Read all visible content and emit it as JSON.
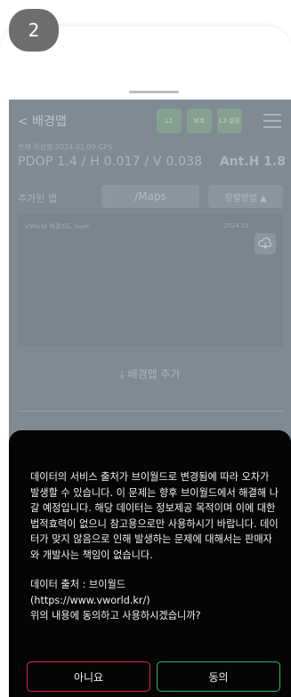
{
  "step_badge": "2",
  "app": {
    "title": "< 배경맵",
    "header_buttons": [
      "L1",
      "보호",
      "L3 설정"
    ],
    "info_line": "현재 위성맵 2024.01.09 GPS",
    "pdop": "PDOP 1.4 / H 0.017 / V 0.038",
    "ant": "Ant.H 1.8",
    "row_label": "추가된 맵",
    "map_button": "/Maps",
    "sort_button": "정렬방법 ▲",
    "list_item_text": "VWorld 배경지도 layer",
    "list_item_date": "2024.01",
    "add_layer": "배경맵 추가"
  },
  "modal": {
    "message": "데이터의 서비스 출처가 브이월드로 변경됨에 따라 오차가 발생할 수 있습니다. 이 문제는 향후 브이월드에서 해결해 나갈 예정입니다. 해당 데이터는 정보제공 목적이며 이에 대한 법적효력이 없으니 참고용으로만 사용하시기 바랍니다. 데이터가 맞지 않음으로 인해 발생하는 문제에 대해서는 판매자와 개발사는 책임이 없습니다.",
    "source_label": "데이터 출처 : 브이월드",
    "source_url": "(https://www.vworld.kr/)",
    "question": "위의 내용에 동의하고 사용하시겠습니까?",
    "no_label": "아니요",
    "yes_label": "동의"
  },
  "colors": {
    "modal_bg": "#050505",
    "no_border": "#d02a4a",
    "yes_border": "#2fb864",
    "app_dim": "#7f8a93"
  }
}
